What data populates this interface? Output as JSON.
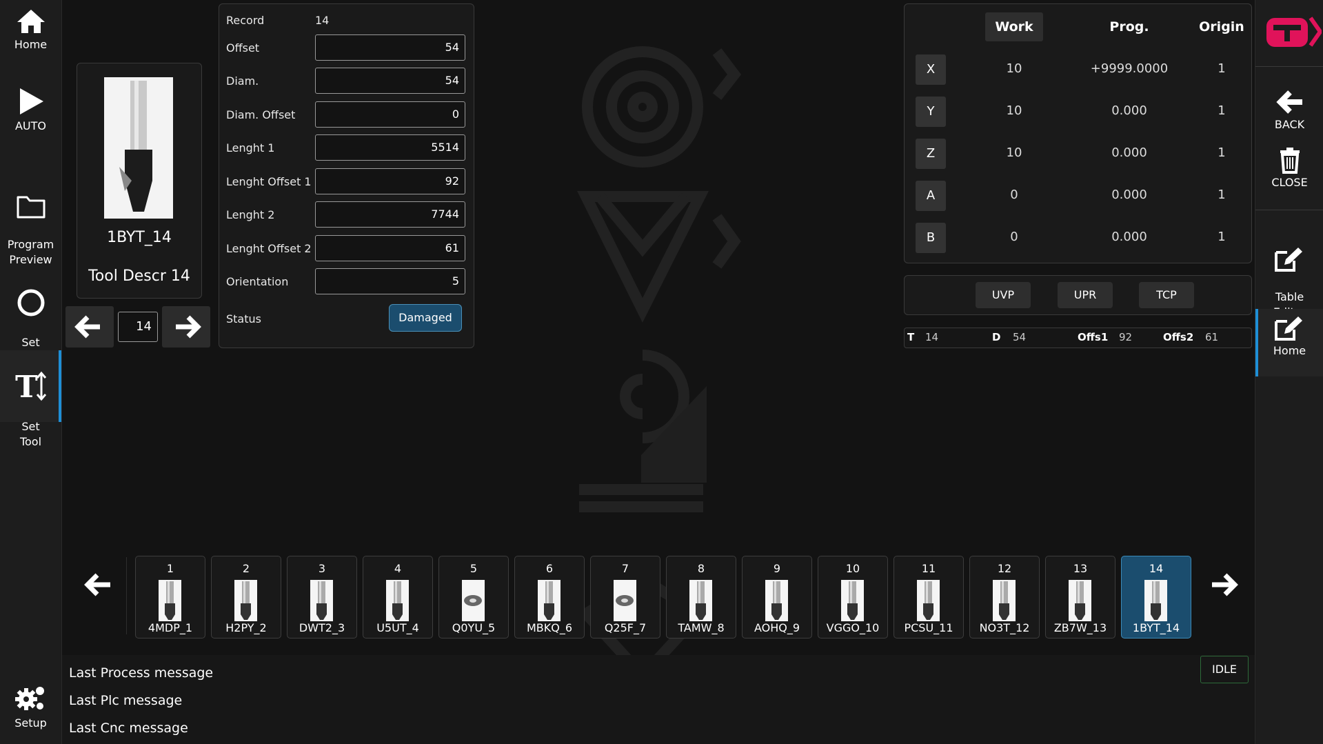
{
  "left_nav": [
    {
      "label": "Home",
      "icon": "home-icon"
    },
    {
      "label": "AUTO",
      "icon": "play-icon"
    },
    {
      "label": "Program\nPreview",
      "icon": "folder-icon"
    },
    {
      "label": "Set\nOrigin",
      "icon": "origin-circle-icon"
    },
    {
      "label": "Set\nTool",
      "icon": "tool-text-icon",
      "active": true
    },
    {
      "label": "Setup",
      "icon": "gear-icon"
    }
  ],
  "right_nav": [
    {
      "label": "BACK",
      "icon": "back-arrow-icon"
    },
    {
      "label": "CLOSE",
      "icon": "trash-icon"
    },
    {
      "label": "Table\nEditor",
      "icon": "edit-icon"
    },
    {
      "label": "Home",
      "icon": "edit-icon",
      "active": true
    }
  ],
  "tool_preview": {
    "name": "1BYT_14",
    "description": "Tool Descr 14",
    "current_index": "14"
  },
  "record": {
    "record_label": "Record",
    "record_value": "14",
    "fields": [
      {
        "label": "Offset",
        "value": "54"
      },
      {
        "label": "Diam.",
        "value": "54"
      },
      {
        "label": "Diam. Offset",
        "value": "0"
      },
      {
        "label": "Lenght 1",
        "value": "5514"
      },
      {
        "label": "Lenght Offset 1",
        "value": "92"
      },
      {
        "label": "Lenght 2",
        "value": "7744"
      },
      {
        "label": "Lenght Offset 2",
        "value": "61"
      },
      {
        "label": "Orientation",
        "value": "5"
      }
    ],
    "status_label": "Status",
    "status_value": "Damaged"
  },
  "axes": {
    "headers": {
      "work": "Work",
      "prog": "Prog.",
      "origin": "Origin"
    },
    "rows": [
      {
        "axis": "X",
        "work": "10",
        "prog": "+9999.0000",
        "origin": "1"
      },
      {
        "axis": "Y",
        "work": "10",
        "prog": "0.000",
        "origin": "1"
      },
      {
        "axis": "Z",
        "work": "10",
        "prog": "0.000",
        "origin": "1"
      },
      {
        "axis": "A",
        "work": "0",
        "prog": "0.000",
        "origin": "1"
      },
      {
        "axis": "B",
        "work": "0",
        "prog": "0.000",
        "origin": "1"
      }
    ]
  },
  "modes": [
    "UVP",
    "UPR",
    "TCP"
  ],
  "tool_status": {
    "t_label": "T",
    "t_value": "14",
    "d_label": "D",
    "d_value": "54",
    "offs1_label": "Offs1",
    "offs1_value": "92",
    "offs2_label": "Offs2",
    "offs2_value": "61"
  },
  "tools": [
    {
      "num": "1",
      "name": "4MDP_1"
    },
    {
      "num": "2",
      "name": "H2PY_2"
    },
    {
      "num": "3",
      "name": "DWT2_3"
    },
    {
      "num": "4",
      "name": "U5UT_4"
    },
    {
      "num": "5",
      "name": "Q0YU_5"
    },
    {
      "num": "6",
      "name": "MBKQ_6"
    },
    {
      "num": "7",
      "name": "Q25F_7"
    },
    {
      "num": "8",
      "name": "TAMW_8"
    },
    {
      "num": "9",
      "name": "AOHQ_9"
    },
    {
      "num": "10",
      "name": "VGGO_10"
    },
    {
      "num": "11",
      "name": "PCSU_11"
    },
    {
      "num": "12",
      "name": "NO3T_12"
    },
    {
      "num": "13",
      "name": "ZB7W_13"
    },
    {
      "num": "14",
      "name": "1BYT_14",
      "selected": true
    }
  ],
  "messages": {
    "process": "Last Process message",
    "plc": "Last Plc message",
    "cnc": "Last Cnc message"
  },
  "state_badge": "IDLE",
  "colors": {
    "accent": "#1e8fd6",
    "selected": "#1b4d6e",
    "brand": "#e0135a"
  }
}
